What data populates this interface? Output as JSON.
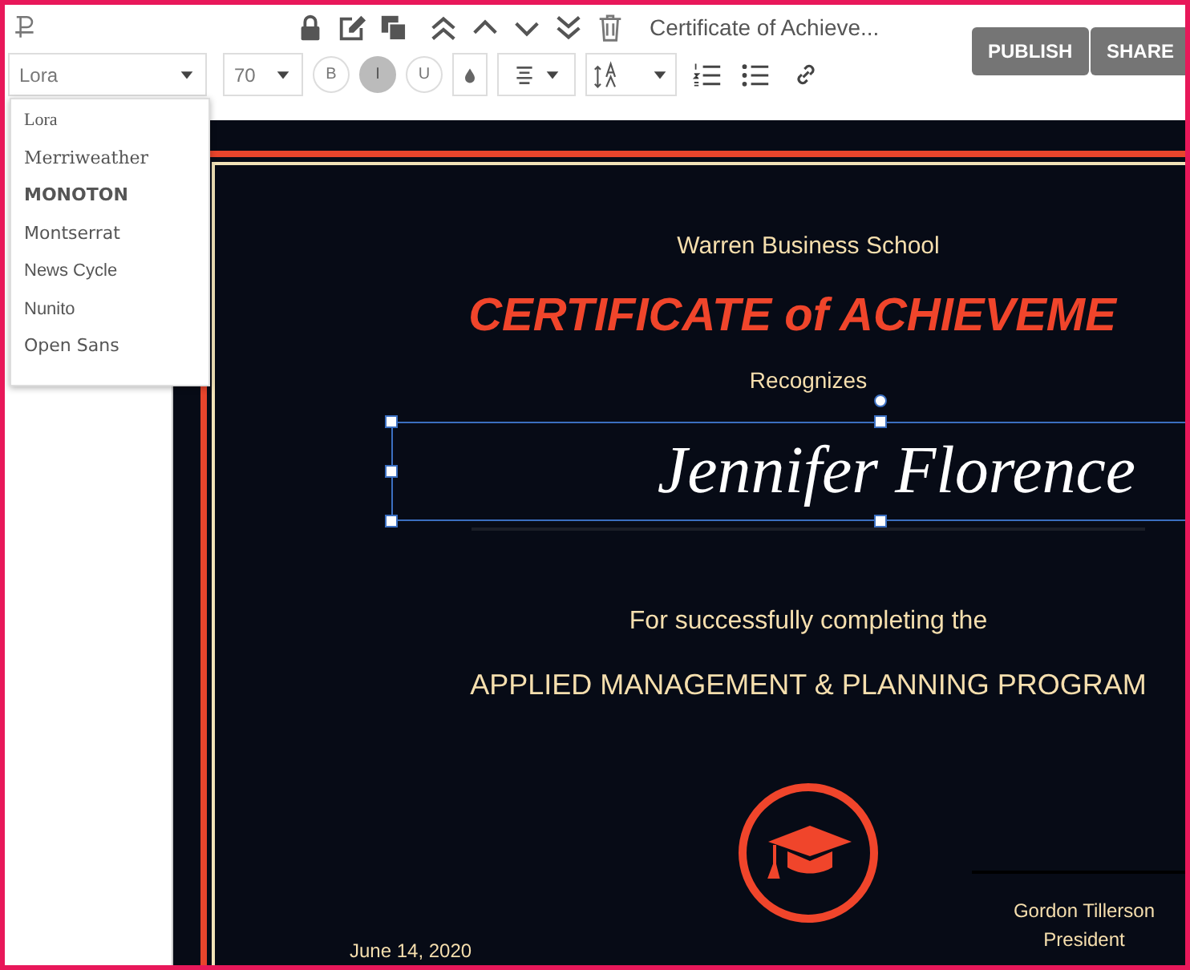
{
  "toolbar": {
    "document_title": "Certificate of Achieve...",
    "buttons": [
      "PUBLISH",
      "SHARE"
    ]
  },
  "format_bar": {
    "font": "Lora",
    "size": "70",
    "styles": [
      {
        "label": "B",
        "selected": false
      },
      {
        "label": "I",
        "selected": true
      },
      {
        "label": "U",
        "selected": false
      }
    ]
  },
  "font_menu": {
    "items": [
      "Lora",
      "Merriweather",
      "MONOTON",
      "Montserrat",
      "News Cycle",
      "Nunito",
      "Open Sans"
    ]
  },
  "certificate": {
    "school": "Warren Business School",
    "title": "CERTIFICATE of ACHIEVEME",
    "recognizes": "Recognizes",
    "recipient": {
      "text": "Jennifer Florence",
      "selected": true
    },
    "completion": "For successfully completing the",
    "program": "APPLIED MANAGEMENT & PLANNING PROGRAM",
    "date": "June 14, 2020",
    "signer_name": "Gordon Tillerson",
    "signer_title": "President"
  }
}
